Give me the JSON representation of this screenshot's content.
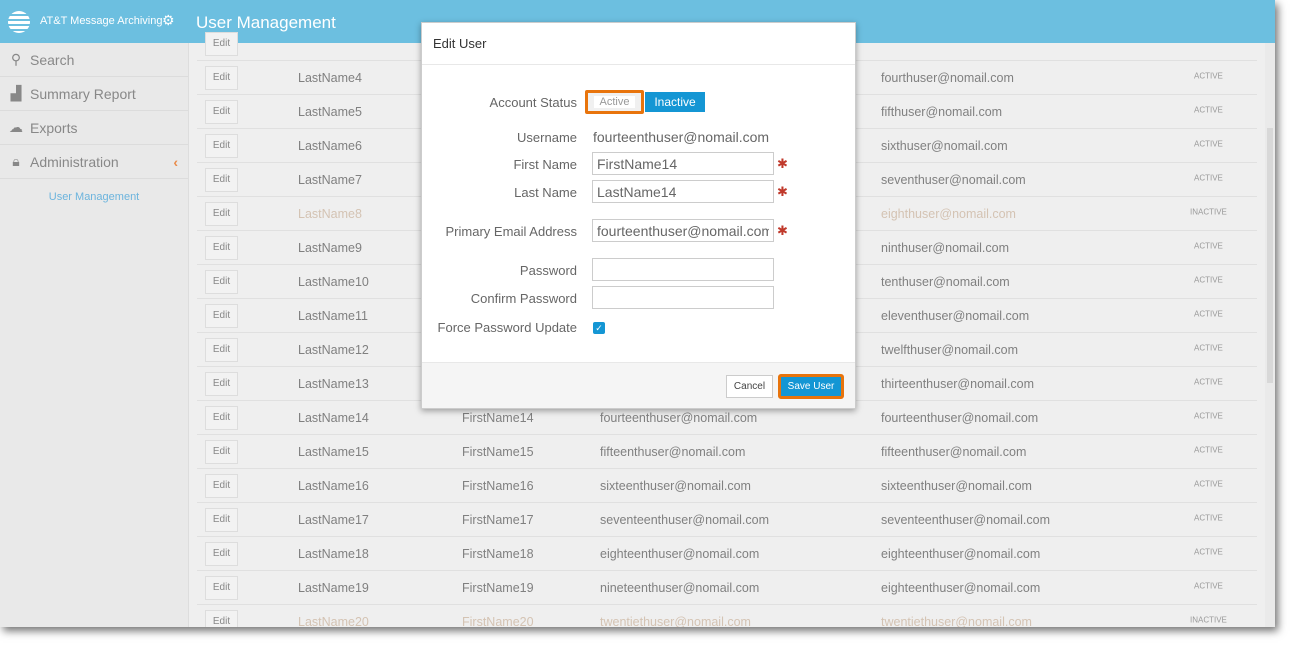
{
  "header": {
    "brand": "AT&T Message Archiving",
    "title": "User Management"
  },
  "sidebar": {
    "items": [
      {
        "label": "Search",
        "icon": "search-icon"
      },
      {
        "label": "Summary Report",
        "icon": "bar-chart-icon"
      },
      {
        "label": "Exports",
        "icon": "cloud-download-icon"
      },
      {
        "label": "Administration",
        "icon": "lock-icon"
      }
    ],
    "sub_item": "User Management"
  },
  "table": {
    "edit_label": "Edit",
    "rows": [
      {
        "last": "",
        "first": "",
        "email": "",
        "email2": "",
        "status": ""
      },
      {
        "last": "LastName4",
        "first": "",
        "email": "",
        "email2": "fourthuser@nomail.com",
        "status": "ACTIVE"
      },
      {
        "last": "LastName5",
        "first": "",
        "email": "",
        "email2": "fifthuser@nomail.com",
        "status": "ACTIVE"
      },
      {
        "last": "LastName6",
        "first": "",
        "email": "",
        "email2": "sixthuser@nomail.com",
        "status": "ACTIVE"
      },
      {
        "last": "LastName7",
        "first": "",
        "email": "",
        "email2": "seventhuser@nomail.com",
        "status": "ACTIVE"
      },
      {
        "last": "LastName8",
        "first": "",
        "email": "",
        "email2": "eighthuser@nomail.com",
        "status": "INACTIVE"
      },
      {
        "last": "LastName9",
        "first": "",
        "email": "",
        "email2": "ninthuser@nomail.com",
        "status": "ACTIVE"
      },
      {
        "last": "LastName10",
        "first": "",
        "email": "",
        "email2": "tenthuser@nomail.com",
        "status": "ACTIVE"
      },
      {
        "last": "LastName11",
        "first": "",
        "email": "",
        "email2": "eleventhuser@nomail.com",
        "status": "ACTIVE"
      },
      {
        "last": "LastName12",
        "first": "",
        "email": "",
        "email2": "twelfthuser@nomail.com",
        "status": "ACTIVE"
      },
      {
        "last": "LastName13",
        "first": "",
        "email": "",
        "email2": "thirteenthuser@nomail.com",
        "status": "ACTIVE"
      },
      {
        "last": "LastName14",
        "first": "FirstName14",
        "email": "fourteenthuser@nomail.com",
        "email2": "fourteenthuser@nomail.com",
        "status": "ACTIVE"
      },
      {
        "last": "LastName15",
        "first": "FirstName15",
        "email": "fifteenthuser@nomail.com",
        "email2": "fifteenthuser@nomail.com",
        "status": "ACTIVE"
      },
      {
        "last": "LastName16",
        "first": "FirstName16",
        "email": "sixteenthuser@nomail.com",
        "email2": "sixteenthuser@nomail.com",
        "status": "ACTIVE"
      },
      {
        "last": "LastName17",
        "first": "FirstName17",
        "email": "seventeenthuser@nomail.com",
        "email2": "seventeenthuser@nomail.com",
        "status": "ACTIVE"
      },
      {
        "last": "LastName18",
        "first": "FirstName18",
        "email": "eighteenthuser@nomail.com",
        "email2": "eighteenthuser@nomail.com",
        "status": "ACTIVE"
      },
      {
        "last": "LastName19",
        "first": "FirstName19",
        "email": "nineteenthuser@nomail.com",
        "email2": "eighteenthuser@nomail.com",
        "status": "ACTIVE"
      },
      {
        "last": "LastName20",
        "first": "FirstName20",
        "email": "twentiethuser@nomail.com",
        "email2": "twentiethuser@nomail.com",
        "status": "INACTIVE"
      }
    ]
  },
  "modal": {
    "title": "Edit User",
    "account_status_label": "Account Status",
    "active_label": "Active",
    "inactive_label": "Inactive",
    "username_label": "Username",
    "username": "fourteenthuser@nomail.com",
    "first_name_label": "First Name",
    "first_name": "FirstName14",
    "last_name_label": "Last Name",
    "last_name": "LastName14",
    "email_label": "Primary Email Address",
    "email": "fourteenthuser@nomail.com",
    "password_label": "Password",
    "password": "",
    "confirm_label": "Confirm Password",
    "confirm": "",
    "force_label": "Force Password Update",
    "force_checked": true,
    "required_mark": "✱",
    "cancel": "Cancel",
    "save": "Save User"
  },
  "colors": {
    "header": "#6cbfe0",
    "accent": "#1496d4",
    "highlight": "#e8740c"
  }
}
